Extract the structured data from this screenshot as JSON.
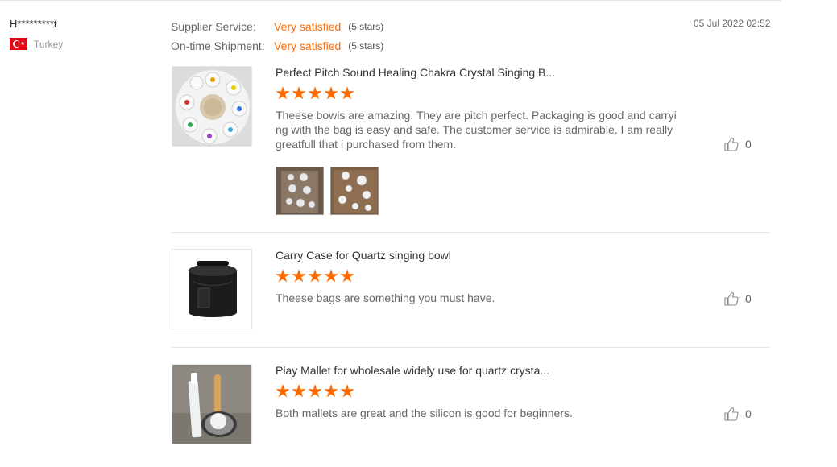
{
  "reviewer": {
    "name": "H*********t",
    "country": "Turkey",
    "flag_icon": "turkey-flag-icon"
  },
  "ratings": [
    {
      "label": "Supplier Service:",
      "value": "Very satisfied",
      "stars": "(5 stars)"
    },
    {
      "label": "On-time Shipment:",
      "value": "Very satisfied",
      "stars": "(5 stars)"
    }
  ],
  "date": "05 Jul 2022 02:52",
  "accent_color": "#ff6a00",
  "items": [
    {
      "title": "Perfect Pitch Sound Healing Chakra Crystal Singing B...",
      "rating": 5,
      "text": "Theese bowls are amazing. They are pitch perfect. Packaging is good and carrying with the bag is easy and safe. The customer service is admirable. I am really greatfull that i purchased from them.",
      "likes": "0"
    },
    {
      "title": "Carry Case for Quartz singing bowl",
      "rating": 5,
      "text": "Theese bags are something you must have.",
      "likes": "0"
    },
    {
      "title": "Play Mallet for wholesale widely use for quartz crysta...",
      "rating": 5,
      "text": "Both mallets are great and the silicon is good for beginners.",
      "likes": "0"
    }
  ]
}
